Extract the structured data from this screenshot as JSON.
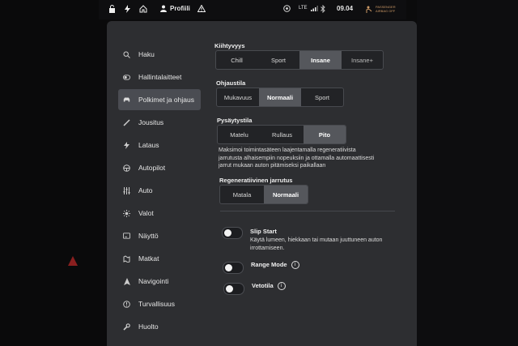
{
  "statusbar": {
    "profile_label": "Profiili",
    "lte_label": "LTE",
    "time": "09.04",
    "passenger_line1": "PASSENGER",
    "passenger_line2": "AIRBAG OFF"
  },
  "sidebar": {
    "items": [
      {
        "label": "Haku",
        "icon": "search-icon"
      },
      {
        "label": "Hallintalaitteet",
        "icon": "toggle-icon"
      },
      {
        "label": "Polkimet ja ohjaus",
        "icon": "car-icon"
      },
      {
        "label": "Jousitus",
        "icon": "suspension-icon"
      },
      {
        "label": "Lataus",
        "icon": "bolt-icon"
      },
      {
        "label": "Autopilot",
        "icon": "steering-wheel-icon"
      },
      {
        "label": "Auto",
        "icon": "sliders-icon"
      },
      {
        "label": "Valot",
        "icon": "light-icon"
      },
      {
        "label": "Näyttö",
        "icon": "display-icon"
      },
      {
        "label": "Matkat",
        "icon": "trips-icon"
      },
      {
        "label": "Navigointi",
        "icon": "navigation-icon"
      },
      {
        "label": "Turvallisuus",
        "icon": "safety-icon"
      },
      {
        "label": "Huolto",
        "icon": "wrench-icon"
      }
    ],
    "active_index": 2
  },
  "acceleration": {
    "label": "Kiihtyvyys",
    "options": [
      "Chill",
      "Sport",
      "Insane",
      "Insane+"
    ],
    "selected": "Insane"
  },
  "steering": {
    "label": "Ohjaustila",
    "options": [
      "Mukavuus",
      "Normaali",
      "Sport"
    ],
    "selected": "Normaali"
  },
  "stopping": {
    "label": "Pysäytystila",
    "options": [
      "Matelu",
      "Rullaus",
      "Pito"
    ],
    "selected": "Pito",
    "description_lines": [
      "Maksimoi toimintasäteen laajentamalla regeneratiivista",
      "jarrutusta alhaisempiin nopeuksiin ja ottamalla automaattisesti",
      "jarrut mukaan auton pitämiseksi paikallaan"
    ]
  },
  "regen": {
    "label": "Regeneratiivinen jarrutus",
    "options": [
      "Matala",
      "Normaali"
    ],
    "selected": "Normaali"
  },
  "toggles": {
    "slip_start": {
      "label": "Slip Start",
      "on": false,
      "description_lines": [
        "Käytä lumeen, hiekkaan tai mutaan juuttuneen auton",
        "irrottamiseen."
      ]
    },
    "range_mode": {
      "label": "Range Mode",
      "on": false
    },
    "tow_mode": {
      "label": "Vetotila",
      "on": false
    }
  },
  "colors": {
    "screen_bg": "#2d2e31",
    "selected_segment": "#55575c",
    "warning_red": "#8a1f1f"
  }
}
